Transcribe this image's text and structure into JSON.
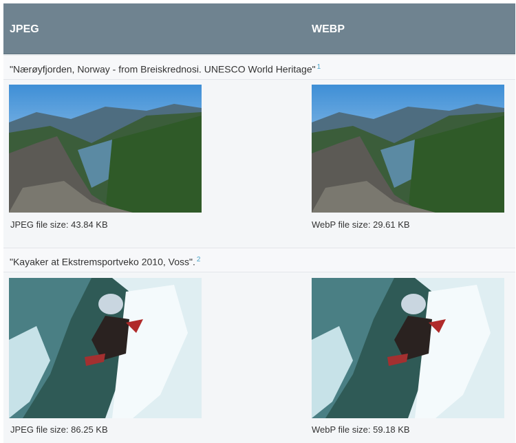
{
  "header": {
    "col1": "JPEG",
    "col2": "WEBP"
  },
  "rows": [
    {
      "caption": "\"Nærøyfjorden, Norway - from Breiskrednosi. UNESCO World Heritage\"",
      "footnote": "1",
      "jpeg_size_label": "JPEG file size: 43.84 KB",
      "webp_size_label": "WebP file size: 29.61 KB",
      "image_icon": "fjord-landscape-photo"
    },
    {
      "caption": "\"Kayaker at Ekstremsportveko 2010, Voss\".",
      "footnote": "2",
      "jpeg_size_label": "JPEG file size: 86.25 KB",
      "webp_size_label": "WebP file size: 59.18 KB",
      "image_icon": "kayaker-whitewater-photo"
    }
  ]
}
